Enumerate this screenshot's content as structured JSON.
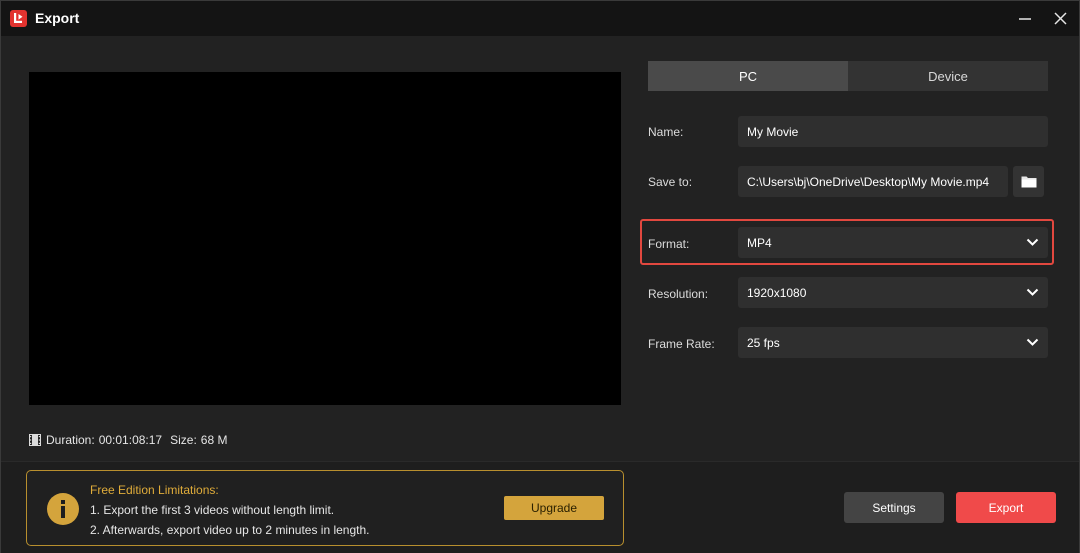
{
  "window": {
    "title": "Export",
    "app_icon": "app-logo-icon"
  },
  "preview": {
    "duration_label": "Duration:",
    "duration_value": "00:01:08:17",
    "size_label": "Size:",
    "size_value": "68 M"
  },
  "tabs": [
    {
      "label": "PC",
      "selected": true
    },
    {
      "label": "Device",
      "selected": false
    }
  ],
  "form": {
    "name_label": "Name:",
    "name_value": "My Movie",
    "save_to_label": "Save to:",
    "save_to_value": "C:\\Users\\bj\\OneDrive\\Desktop\\My Movie.mp4",
    "format_label": "Format:",
    "format_value": "MP4",
    "resolution_label": "Resolution:",
    "resolution_value": "1920x1080",
    "frame_rate_label": "Frame Rate:",
    "frame_rate_value": "25 fps"
  },
  "notice": {
    "title": "Free Edition Limitations:",
    "line1": "1. Export the first 3 videos without length limit.",
    "line2": "2. Afterwards, export video up to 2 minutes in length.",
    "upgrade_label": "Upgrade"
  },
  "actions": {
    "settings_label": "Settings",
    "export_label": "Export"
  },
  "colors": {
    "accent_red": "#f04a4a",
    "highlight_border": "#e2483f",
    "notice_gold": "#d4a43c"
  }
}
